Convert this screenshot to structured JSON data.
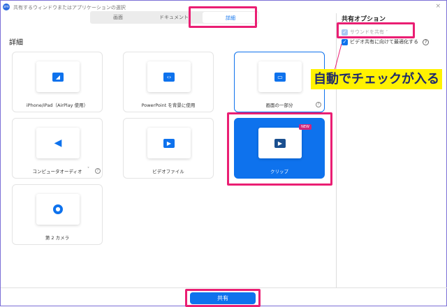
{
  "window": {
    "title": "共有するウィンドウまたはアプリケーションの選択",
    "logo": "zm",
    "close": "×"
  },
  "tabs": [
    {
      "label": "画面"
    },
    {
      "label": "ドキュメント"
    },
    {
      "label": "詳細",
      "active": true
    }
  ],
  "section_heading": "詳細",
  "cards": [
    {
      "label": "iPhone/iPad（AirPlay 使用）",
      "icon": "airplay-icon"
    },
    {
      "label": "PowerPoint を背景に使用",
      "icon": "powerpoint-icon"
    },
    {
      "label": "画面の一部分",
      "icon": "screen-portion-icon",
      "help": "?"
    },
    {
      "label": "コンピュータオーディオ",
      "icon": "speaker-icon",
      "help": "?",
      "dropdown": "˅"
    },
    {
      "label": "ビデオファイル",
      "icon": "film-icon"
    },
    {
      "label": "クリップ",
      "icon": "clip-icon",
      "badge": "NEW"
    },
    {
      "label": "第 2 カメラ",
      "icon": "camera-icon"
    }
  ],
  "options": {
    "title": "共有オプション",
    "sound": {
      "label": "サウンドを共有",
      "checked": true,
      "disabled": true
    },
    "optimize": {
      "label": "ビデオ共有に向けて最適化する",
      "checked": true,
      "help": "?"
    }
  },
  "annotation": "自動でチェックが入る",
  "share_button": "共有",
  "colors": {
    "accent": "#0e72ed",
    "highlight": "#ea1e73",
    "callout": "#fff200"
  }
}
